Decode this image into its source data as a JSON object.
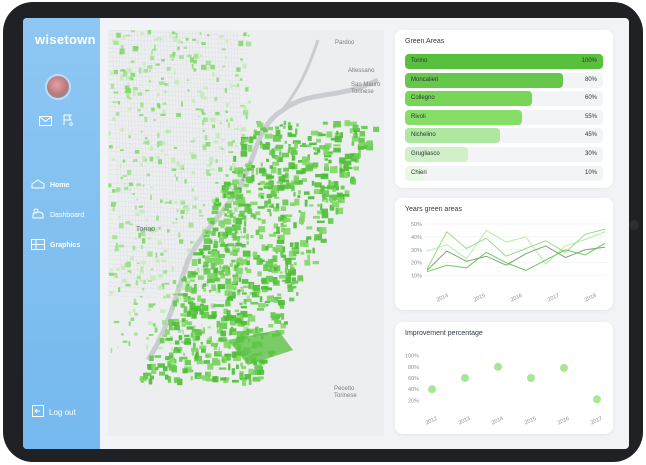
{
  "sidebar": {
    "logo": "wisetown",
    "nav": [
      {
        "label": "Home",
        "icon": "home-icon"
      },
      {
        "label": "Dashboard",
        "icon": "dashboard-icon"
      },
      {
        "label": "Graphics",
        "icon": "graphics-icon"
      }
    ],
    "logout": "Log out"
  },
  "map": {
    "labels": [
      "Pardoo",
      "Torino",
      "Pecetto Torinese",
      "San Mauro Torinese",
      "Altessano"
    ]
  },
  "colors": {
    "sidebar": "#7dbdf0",
    "green_dark": "#4cbd34",
    "green_light": "#c7efbd"
  },
  "green_areas": {
    "title": "Green Areas",
    "items": [
      {
        "label": "Torino",
        "value": "100%",
        "fraction": 1.0,
        "color": "#59c03e"
      },
      {
        "label": "Moncalieri",
        "value": "80%",
        "fraction": 0.8,
        "color": "#67c74a"
      },
      {
        "label": "Collegno",
        "value": "60%",
        "fraction": 0.64,
        "color": "#77d558"
      },
      {
        "label": "Rivoli",
        "value": "55%",
        "fraction": 0.59,
        "color": "#86dd68"
      },
      {
        "label": "Nichelino",
        "value": "45%",
        "fraction": 0.48,
        "color": "#aee7a0"
      },
      {
        "label": "Grugliasco",
        "value": "30%",
        "fraction": 0.32,
        "color": "#d0f0c7"
      },
      {
        "label": "Chieri",
        "value": "10%",
        "fraction": 0.1,
        "color": "#e9f7e4"
      }
    ]
  },
  "chart_data": [
    {
      "type": "line",
      "title": "Years green areas",
      "x": [
        "2014",
        "2015",
        "2016",
        "2017",
        "2018"
      ],
      "ylim": [
        5,
        50
      ],
      "yticks": [
        "50%",
        "40%",
        "30%",
        "20%",
        "10%"
      ],
      "series": [
        {
          "color": "#b9ebaa",
          "values": [
            29,
            34,
            23,
            45,
            36,
            40,
            19,
            33,
            38,
            44
          ]
        },
        {
          "color": "#94de81",
          "values": [
            15,
            44,
            31,
            39,
            25,
            31,
            37,
            28,
            42,
            46
          ]
        },
        {
          "color": "#6ec95a",
          "values": [
            13,
            18,
            16,
            28,
            20,
            14,
            22,
            30,
            26,
            35
          ]
        },
        {
          "color": "#7fa37a",
          "values": [
            14,
            29,
            21,
            25,
            18,
            27,
            33,
            24,
            30,
            32
          ]
        }
      ]
    },
    {
      "type": "scatter",
      "title": "Improvement percentage",
      "x": [
        "2012",
        "2013",
        "2014",
        "2015",
        "2016",
        "2017"
      ],
      "values": [
        40,
        60,
        80,
        60,
        78,
        22
      ],
      "ylim": [
        10,
        110
      ],
      "yticks": [
        "100%",
        "80%",
        "60%",
        "40%",
        "20%"
      ],
      "color": "#a6e795"
    }
  ]
}
